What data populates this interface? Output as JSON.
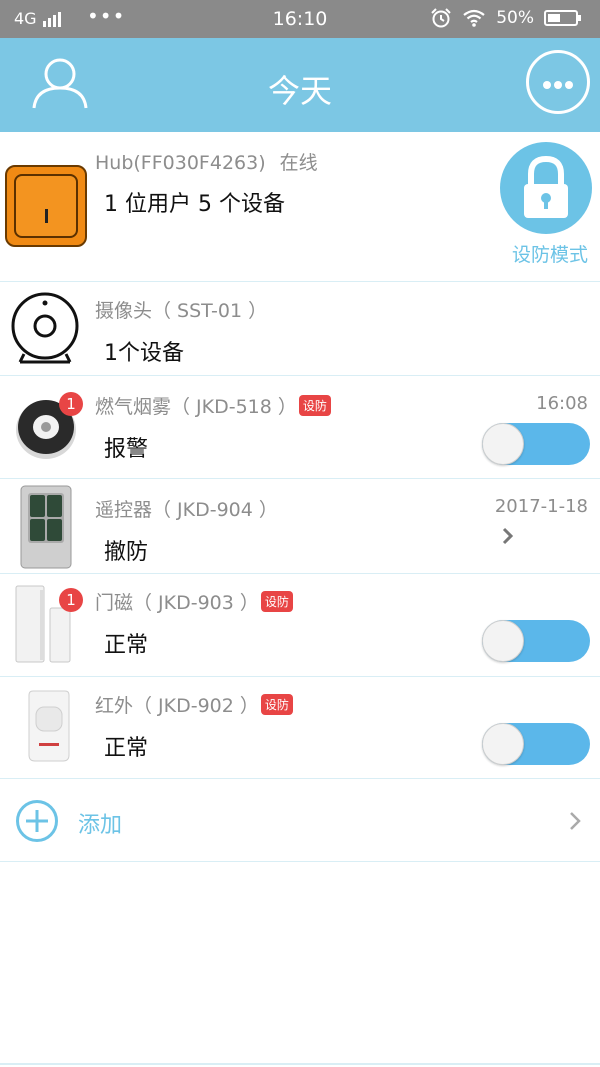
{
  "status_bar": {
    "network": "4G",
    "dots": "•••",
    "time": "16:10",
    "battery": "50%"
  },
  "header": {
    "title": "今天"
  },
  "hub": {
    "name": "Hub(FF030F4263)",
    "online": "在线",
    "summary": "1 位用户  5 个设备",
    "arm_mode_label": "设防模式"
  },
  "devices": [
    {
      "name": "摄像头（ SST-01 ）",
      "status": "1个设备"
    },
    {
      "name": "燃气烟雾（ JKD-518 ）",
      "tag": "设防",
      "status": "报警",
      "time": "16:08",
      "badge": "1",
      "toggle_on": true
    },
    {
      "name": "遥控器（ JKD-904 ）",
      "status": "撤防",
      "time": "2017-1-18"
    },
    {
      "name": "门磁（ JKD-903 ）",
      "tag": "设防",
      "status": "正常",
      "badge": "1",
      "toggle_on": true
    },
    {
      "name": "红外（ JKD-902 ）",
      "tag": "设防",
      "status": "正常",
      "toggle_on": true
    }
  ],
  "add": {
    "label": "添加"
  },
  "colors": {
    "header": "#7cc7e4",
    "accent": "#6cc3e6",
    "badge": "#e84545",
    "toggle": "#5bb7ea"
  }
}
